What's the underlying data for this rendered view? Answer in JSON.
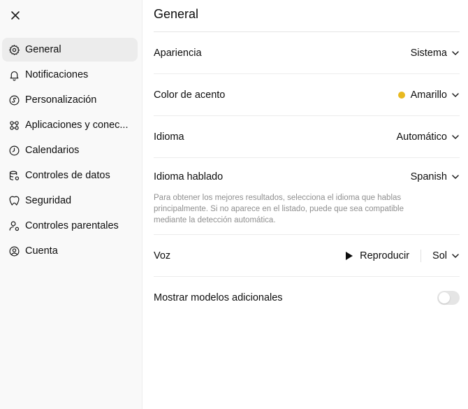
{
  "sidebar": {
    "close_icon": "close-icon",
    "items": [
      {
        "label": "General",
        "icon": "gear-icon",
        "active": true
      },
      {
        "label": "Notificaciones",
        "icon": "bell-icon"
      },
      {
        "label": "Personalización",
        "icon": "personalization-icon"
      },
      {
        "label": "Aplicaciones y conec...",
        "icon": "apps-icon"
      },
      {
        "label": "Calendarios",
        "icon": "clock-icon"
      },
      {
        "label": "Controles de datos",
        "icon": "database-icon"
      },
      {
        "label": "Seguridad",
        "icon": "shield-icon"
      },
      {
        "label": "Controles parentales",
        "icon": "parental-icon"
      },
      {
        "label": "Cuenta",
        "icon": "account-icon"
      }
    ]
  },
  "main": {
    "title": "General",
    "appearance": {
      "label": "Apariencia",
      "value": "Sistema"
    },
    "accent": {
      "label": "Color de acento",
      "value": "Amarillo",
      "color": "#e8b920"
    },
    "language": {
      "label": "Idioma",
      "value": "Automático"
    },
    "spoken_language": {
      "label": "Idioma hablado",
      "value": "Spanish",
      "help": "Para obtener los mejores resultados, selecciona el idioma que hablas principalmente. Si no aparece en el listado, puede que sea compatible mediante la detección automática."
    },
    "voice": {
      "label": "Voz",
      "play_label": "Reproducir",
      "value": "Sol"
    },
    "additional_models": {
      "label": "Mostrar modelos adicionales",
      "enabled": false
    }
  }
}
